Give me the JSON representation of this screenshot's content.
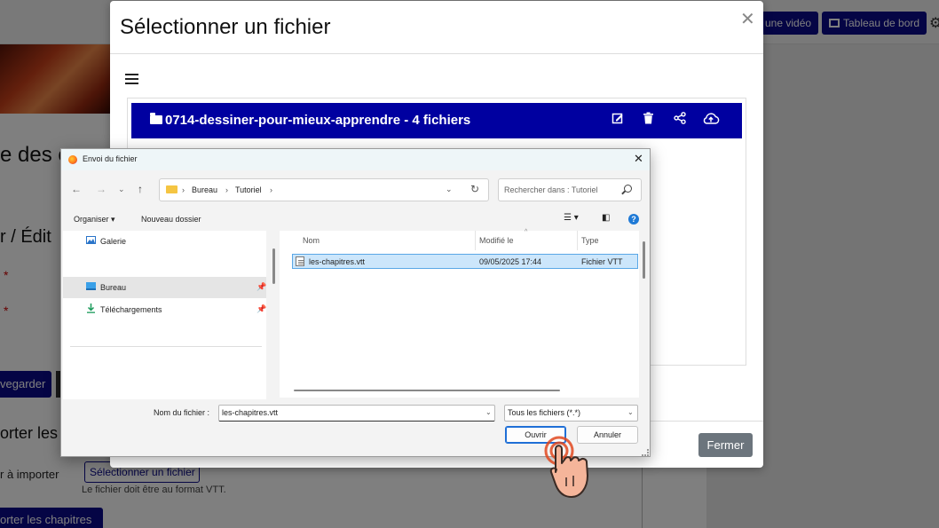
{
  "background": {
    "top_buttons": {
      "video": "une vidéo",
      "dashboard": "Tableau de bord"
    },
    "heading": "e des c",
    "subheading": "r / Édit",
    "star": "*",
    "save_label": "vegarder",
    "import_heading": "orter les",
    "import_label": "r à importer",
    "select_file_button": "Sélectionner un fichier",
    "format_hint": "Le fichier doit être au format VTT.",
    "import_chapters_button": "orter les chapitres"
  },
  "modal": {
    "title": "Sélectionner un fichier",
    "folder_title": "0714-dessiner-pour-mieux-apprendre - 4 fichiers",
    "close_button": "Fermer",
    "folder_actions": [
      "edit-icon",
      "trash-icon",
      "share-icon",
      "cloud-upload-icon"
    ]
  },
  "file_dialog": {
    "title": "Envoi du fichier",
    "path": [
      "Bureau",
      "Tutoriel"
    ],
    "search_placeholder": "Rechercher dans : Tutoriel",
    "toolbar": {
      "organize": "Organiser",
      "new_folder": "Nouveau dossier"
    },
    "nav_items": [
      {
        "label": "Galerie",
        "icon": "gallery-icon"
      },
      {
        "label": "Bureau",
        "icon": "desktop-icon",
        "selected": true,
        "pinned": true
      },
      {
        "label": "Téléchargements",
        "icon": "download-icon",
        "pinned": true
      }
    ],
    "columns": [
      "Nom",
      "Modifié le",
      "Type"
    ],
    "files": [
      {
        "name": "les-chapitres.vtt",
        "modified": "09/05/2025 17:44",
        "type": "Fichier VTT",
        "selected": true
      }
    ],
    "filename_label": "Nom du fichier :",
    "filename_value": "les-chapitres.vtt",
    "filetype_value": "Tous les fichiers (*.*)",
    "open_button": "Ouvrir",
    "cancel_button": "Annuler",
    "help": "?"
  },
  "colors": {
    "brand_navy": "#0b0b8a",
    "folder_bar": "#0000a0",
    "selection": "#cce6fb",
    "secondary_button": "#6c757d"
  }
}
